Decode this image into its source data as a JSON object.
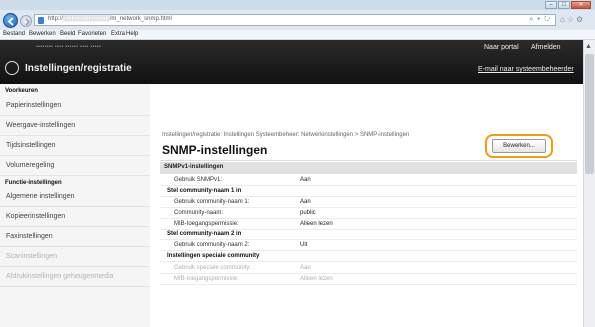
{
  "browser": {
    "url": "http://░░░░░░░░░░░/m_network_snmp.html",
    "menu": [
      "Bestand",
      "Bewerken",
      "Beeld",
      "Favorieten",
      "Extra",
      "Help"
    ]
  },
  "header": {
    "device_info": "••••••••   •••• ••••••  •••• •••••",
    "title": "Instellingen/registratie",
    "portal_link": "Naar portal",
    "logout_link": "Afmelden",
    "admin_mail_link": "E-mail naar systeembeheerder"
  },
  "sidebar": {
    "section1": "Voorkeuren",
    "items1": [
      "Papierinstellingen",
      "Weergave-instellingen",
      "Tijdsinstellingen",
      "Volumeregeling"
    ],
    "section2": "Functie-instellingen",
    "items2": [
      "Algemene instellingen",
      "Kopieerinstellingen",
      "Faxinstellingen",
      "Scaninstellingen",
      "Afdrukinstellingen geheugenmedia"
    ]
  },
  "main": {
    "breadcrumb": "Instellingen/registratie: Instellingen Systeembeheer: Netwerkinstellingen > SNMP-instellingen",
    "page_title": "SNMP-instellingen",
    "edit_button": "Bewerken...",
    "section_title": "SNMPv1-instellingen",
    "use_snmpv1_label": "Gebruik SNMPv1:",
    "use_snmpv1_value": "Aan",
    "community1_header": "Stel community-naam 1 in",
    "use_community1_label": "Gebruik community-naam 1:",
    "use_community1_value": "Aan",
    "community_name_label": "Community-naam:",
    "community_name_value": "public",
    "mib_access_label": "MIB-toegangspermissie:",
    "mib_access_value": "Alleen lezen",
    "community2_header": "Stel community-naam 2 in",
    "use_community2_label": "Gebruik community-naam 2:",
    "use_community2_value": "Uit",
    "special_header": "Instellingen speciale community",
    "use_special_label": "Gebruik speciale community:",
    "use_special_value": "Aan",
    "special_mib_label": "MIB-toegangspermissie:",
    "special_mib_value": "Alleen lezen"
  },
  "colors": {
    "highlight": "#f39a17",
    "header_bg": "#1a1a1a"
  }
}
